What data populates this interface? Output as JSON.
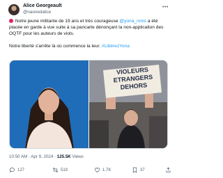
{
  "author": {
    "name": "Alice Georgeault",
    "handle": "@naonedalice"
  },
  "tweet": {
    "text_1_a": " Notre jeune militante de 19 ans et très courageuse ",
    "mention": "@yona_nmis",
    "text_1_b": " a été placée en garde à vue suite à sa pancarte dénonçant la non-application des OQTF pour les auteurs de viols.",
    "text_2_a": "Notre liberté s'arrête là où commence la leur. ",
    "hashtag": "#LibérezYona",
    "sign_text": [
      "VIOLEURS",
      "ETRANGERS",
      "DEHORS"
    ]
  },
  "meta": {
    "time": "10:50 AM · Apr 9, 2024 · ",
    "views": "125.5K",
    "views_label": " Views"
  },
  "actions": {
    "replies": "127",
    "reposts": "519",
    "likes": "1.7K",
    "bookmarks": "37"
  },
  "colors": {
    "accent": "#1d9bf0",
    "text": "#0f1419",
    "muted": "#536471",
    "red_dot": "#e0245e"
  }
}
